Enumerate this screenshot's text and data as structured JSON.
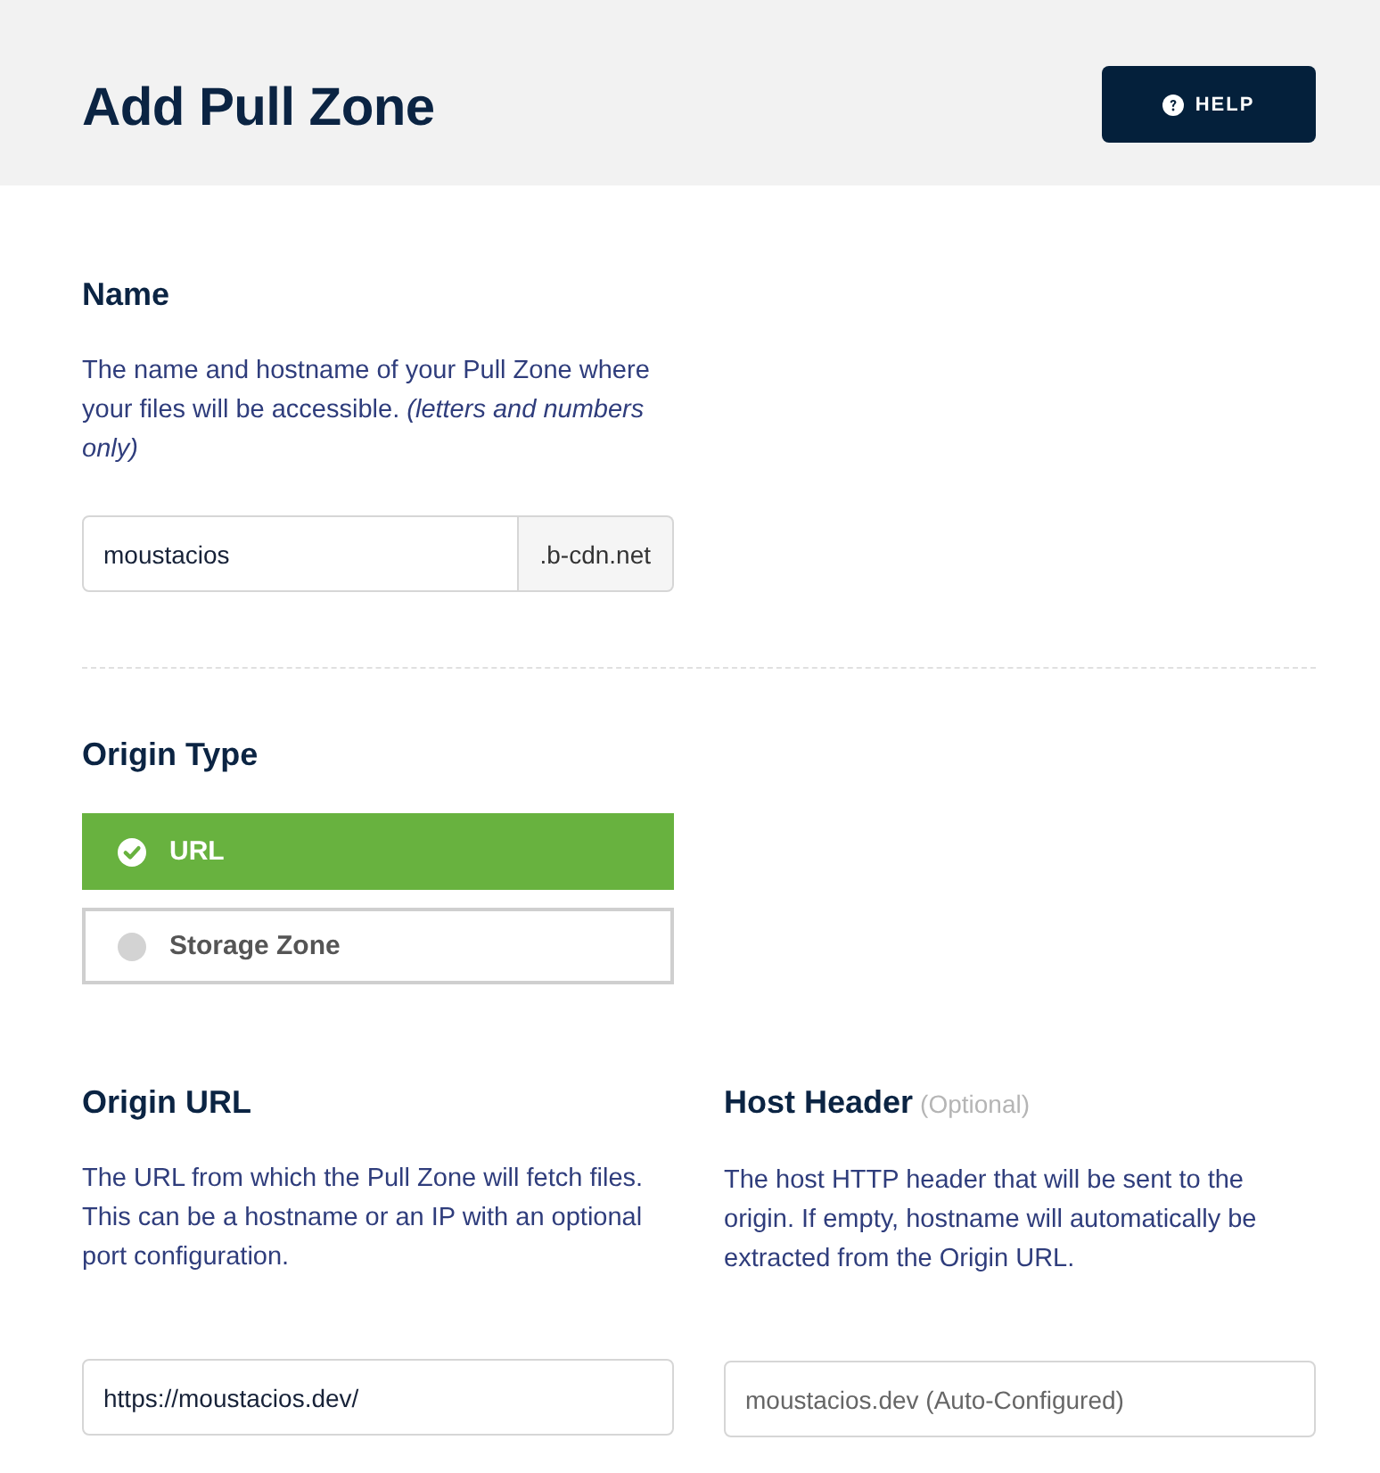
{
  "header": {
    "title": "Add Pull Zone",
    "help_button": "HELP"
  },
  "name_section": {
    "heading": "Name",
    "description": "The name and hostname of your Pull Zone where your files will be accessible. *(letters and numbers only)*",
    "input": {
      "value": "moustacios",
      "suffix": ".b-cdn.net"
    }
  },
  "origin_type": {
    "heading": "Origin Type",
    "options": [
      {
        "label": "URL",
        "selected": true
      },
      {
        "label": "Storage Zone",
        "selected": false
      }
    ]
  },
  "origin_url": {
    "heading": "Origin URL",
    "description": "The URL from which the Pull Zone will fetch files. This can be a hostname or an IP with an optional port configuration.",
    "input": {
      "value": "https://moustacios.dev/"
    }
  },
  "host_header": {
    "heading": "Host Header",
    "note": "(Optional)",
    "description": "The host HTTP header that will be sent to the origin. If empty, hostname will automatically be extracted from the Origin URL.",
    "input": {
      "placeholder": "moustacios.dev (Auto-Configured)"
    }
  }
}
